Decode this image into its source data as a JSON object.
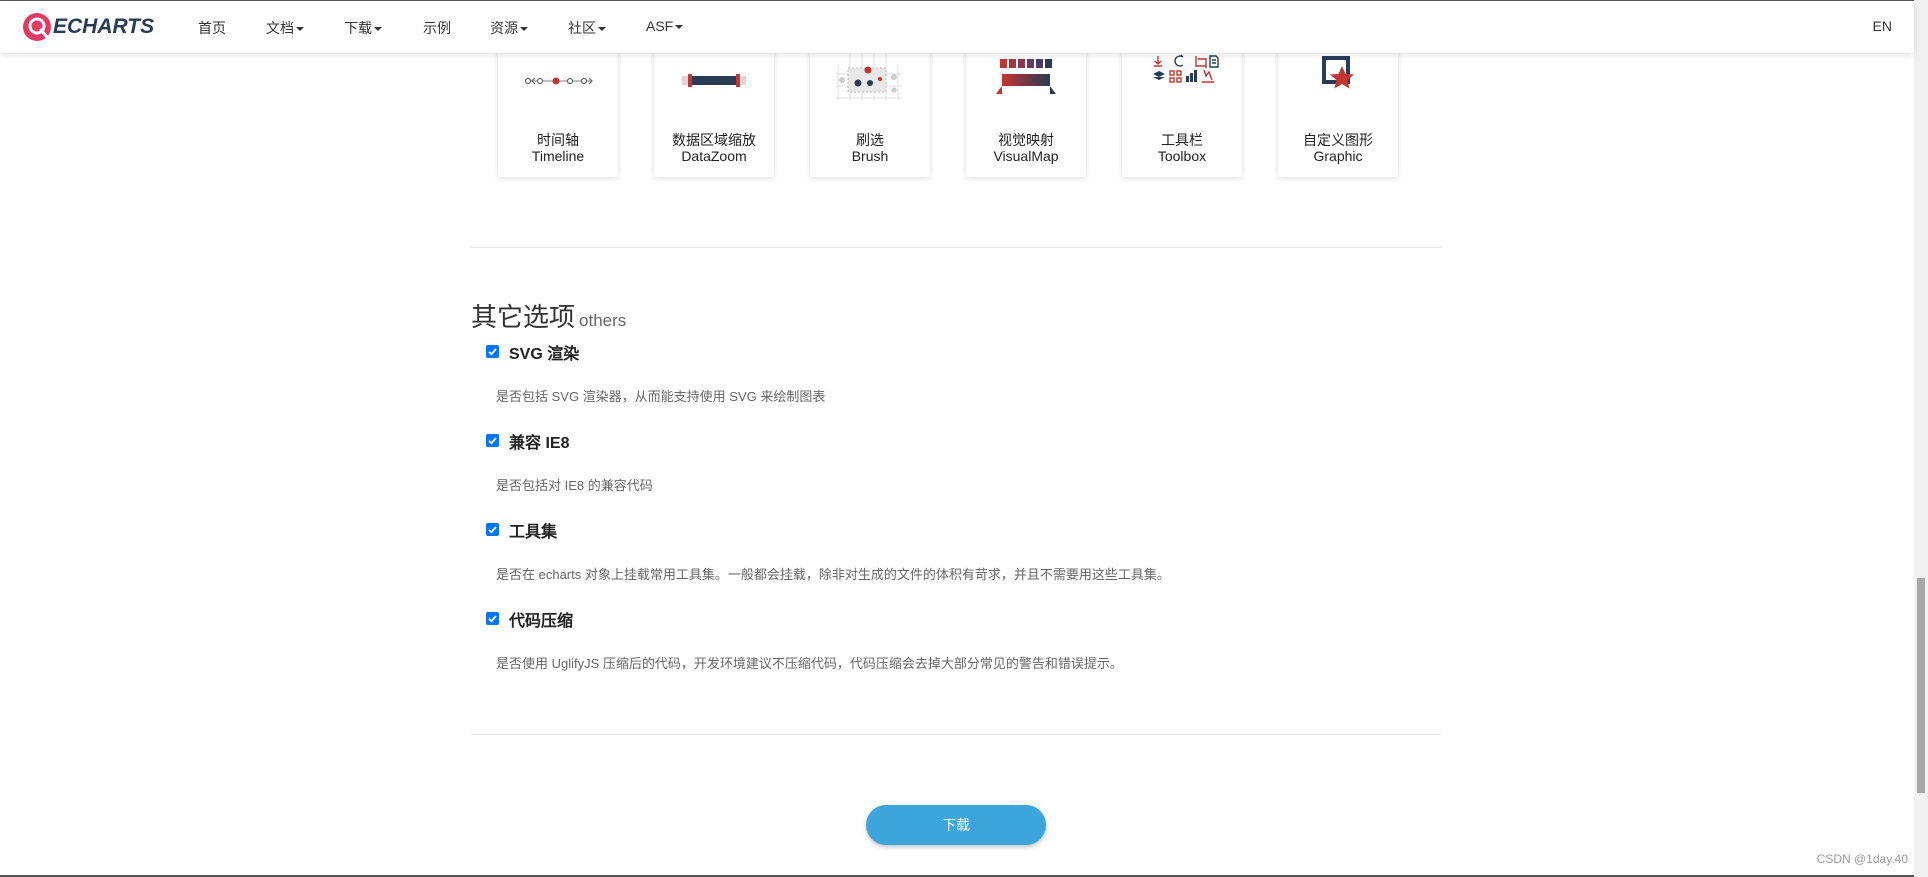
{
  "nav": {
    "logo_text": "ECHARTS",
    "items": [
      {
        "label": "首页",
        "dropdown": false
      },
      {
        "label": "文档",
        "dropdown": true
      },
      {
        "label": "下载",
        "dropdown": true
      },
      {
        "label": "示例",
        "dropdown": false
      },
      {
        "label": "资源",
        "dropdown": true
      },
      {
        "label": "社区",
        "dropdown": true
      },
      {
        "label": "ASF",
        "dropdown": true
      }
    ],
    "lang": "EN"
  },
  "components": [
    {
      "cn": "时间轴",
      "en": "Timeline",
      "icon": "timeline-icon"
    },
    {
      "cn": "数据区域缩放",
      "en": "DataZoom",
      "icon": "datazoom-icon"
    },
    {
      "cn": "刷选",
      "en": "Brush",
      "icon": "brush-icon"
    },
    {
      "cn": "视觉映射",
      "en": "VisualMap",
      "icon": "visualmap-icon"
    },
    {
      "cn": "工具栏",
      "en": "Toolbox",
      "icon": "toolbox-icon"
    },
    {
      "cn": "自定义图形",
      "en": "Graphic",
      "icon": "graphic-icon"
    }
  ],
  "others": {
    "title": "其它选项",
    "title_en": "others",
    "options": [
      {
        "label": "SVG 渲染",
        "checked": true,
        "desc": "是否包括 SVG 渲染器，从而能支持使用 SVG 来绘制图表"
      },
      {
        "label": "兼容 IE8",
        "checked": true,
        "desc": "是否包括对 IE8 的兼容代码"
      },
      {
        "label": "工具集",
        "checked": true,
        "desc": "是否在 echarts 对象上挂载常用工具集。一般都会挂载，除非对生成的文件的体积有苛求，并且不需要用这些工具集。"
      },
      {
        "label": "代码压缩",
        "checked": true,
        "desc": "是否使用 UglifyJS 压缩后的代码，开发环境建议不压缩代码，代码压缩会去掉大部分常见的警告和错误提示。"
      }
    ]
  },
  "download_label": "下载",
  "watermark": "CSDN @1day.40",
  "colors": {
    "accent": "#c23531",
    "navy": "#293c55",
    "button": "#3ca5dc",
    "checkbox": "#0075ff"
  }
}
